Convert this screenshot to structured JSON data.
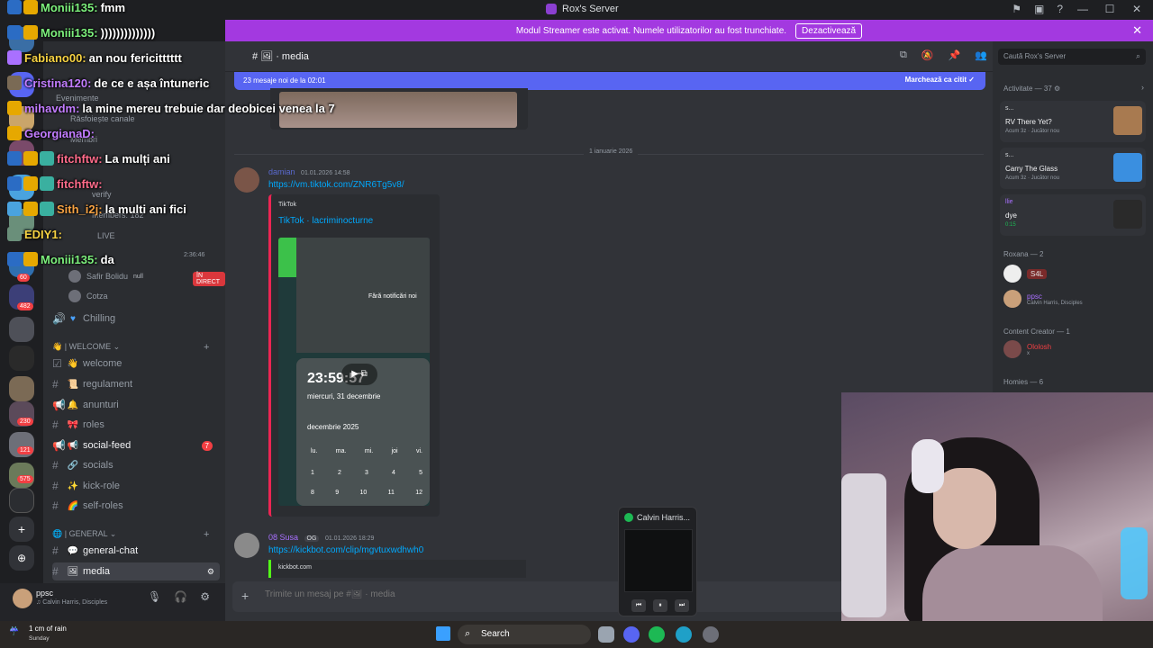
{
  "window": {
    "title": "Rox's Server",
    "controls": [
      "—",
      "☐",
      "✕"
    ],
    "icons": [
      "inbox-icon",
      "screen-icon",
      "help-icon"
    ]
  },
  "banner": {
    "text": "Modul Streamer este activat. Numele utilizatorilor au fost trunchiate.",
    "button": "Dezactivează",
    "close": "✕"
  },
  "rail": {
    "badges": [
      "60",
      "482",
      "230",
      "121",
      "575"
    ],
    "add": "+",
    "explore": "⊕"
  },
  "sidebar": {
    "header_items": [
      "Evenimente",
      "Răsfoiește canale",
      "Membri",
      "verify",
      "Members: 182",
      "LIVE"
    ],
    "voice_users": [
      {
        "name": "Safir Bolidu",
        "tag": "null",
        "live": "ÎN DIRECT"
      },
      {
        "name": "Cotza"
      }
    ],
    "voice_time": "2:36:46",
    "chilling": "Chilling",
    "categories": [
      "| WELCOME",
      "| GENERAL"
    ],
    "channels": [
      {
        "emoji": "👋",
        "label": "welcome"
      },
      {
        "emoji": "📜",
        "label": "regulament"
      },
      {
        "emoji": "🔔",
        "label": "anunturi"
      },
      {
        "emoji": "🎀",
        "label": "roles"
      },
      {
        "emoji": "📢",
        "label": "social-feed",
        "badge": "7"
      },
      {
        "emoji": "🔗",
        "label": "socials"
      },
      {
        "emoji": "✨",
        "label": "kick-role"
      },
      {
        "emoji": "🌈",
        "label": "self-roles"
      },
      {
        "emoji": "💬",
        "label": "general-chat"
      },
      {
        "emoji": "🖼",
        "label": "media"
      }
    ]
  },
  "user_panel": {
    "name": "ppsc",
    "activity": "Calvin Harris, Disciples"
  },
  "main": {
    "channel_name": "media",
    "new_messages": "23 mesaje noi de la 02:01",
    "mark_read": "Marchează ca citit",
    "date_divider": "1 ianuarie 2026",
    "messages": [
      {
        "author": "damian",
        "timestamp": "01.01.2026 14:58",
        "link": "https://vm.tiktok.com/ZNR6Tg5v8/",
        "embed_provider": "TikTok",
        "embed_title": "TikTok · lacriminocturne"
      },
      {
        "author": "08 Susa",
        "tag": "OG",
        "timestamp": "01.01.2026 18:29",
        "link": "https://kickbot.com/clip/mgvtuxwdhwh0",
        "embed_provider": "kickbot.com"
      }
    ],
    "video": {
      "notification": "Fără notificări noi",
      "clock": "23:59:57",
      "date": "miercuri, 31 decembrie",
      "month": "decembrie 2025",
      "weekdays": [
        "lu.",
        "ma.",
        "mi.",
        "joi",
        "vi."
      ],
      "row1": [
        "1",
        "2",
        "3",
        "4",
        "5"
      ],
      "row2": [
        "8",
        "9",
        "10",
        "11",
        "12"
      ]
    },
    "composer_placeholder": "Trimite un mesaj pe #🖼 · media"
  },
  "right": {
    "search_placeholder": "Caută Rox's Server",
    "activity_header": "Activitate — 37",
    "activities": [
      {
        "user": "s...",
        "game": "RV There Yet?",
        "meta": "Acum 3z · Jucător nou"
      },
      {
        "user": "s...",
        "game": "Carry The Glass",
        "meta": "Acum 3z · Jucător nou"
      },
      {
        "user": "llie",
        "game": "dye",
        "meta": "0:15"
      }
    ],
    "roles": [
      {
        "name": "Roxana — 2"
      },
      {
        "name": "Content Creator — 1"
      },
      {
        "name": "Homies — 6"
      }
    ],
    "members": [
      {
        "name": "S4L"
      },
      {
        "name": "ppsc",
        "sub": "Calvin Harris, Disciples"
      },
      {
        "name": "Ololosh",
        "sub": "x"
      }
    ]
  },
  "chat_overlay": [
    {
      "user": "Moniii135:",
      "text": "fmm"
    },
    {
      "user": "Moniii135:",
      "text": "))))))))))))))"
    },
    {
      "user": "Fabiano00:",
      "text": "an nou fericitttttt"
    },
    {
      "user": "Cristina120:",
      "text": "de ce e așa întuneric"
    },
    {
      "user": "mihavdm:",
      "text": "la mine mereu trebuie dar deobicei venea la 7"
    },
    {
      "user": "GeorgianaD:",
      "text": ""
    },
    {
      "user": "fitchftw:",
      "text": "La mulți ani"
    },
    {
      "user": "fitchftw:",
      "text": ""
    },
    {
      "user": "Sith_i2j:",
      "text": "la multi ani fici"
    },
    {
      "user": "EDIY1:",
      "text": ""
    },
    {
      "user": "Moniii135:",
      "text": "da"
    }
  ],
  "spotify": {
    "title": "Calvin Harris...",
    "controls": [
      "⏮",
      "⏸",
      "⏭"
    ]
  },
  "taskbar": {
    "weather_line1": "1 cm of rain",
    "weather_line2": "Sunday",
    "search": "Search"
  },
  "colors": {
    "banner": "#a339e0",
    "blurple": "#5865f2",
    "link": "#00a8fc",
    "tiktok": "#ed2553",
    "kick": "#53fc18"
  }
}
